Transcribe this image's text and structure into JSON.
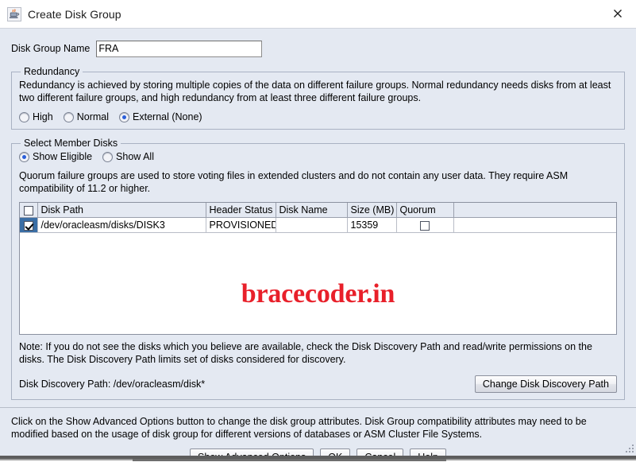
{
  "window": {
    "title": "Create Disk Group",
    "icon": "java-coffee-cup-icon",
    "close_label": "×"
  },
  "form": {
    "disk_group_name_label": "Disk Group Name",
    "disk_group_name_value": "FRA",
    "disk_group_name_placeholder": ""
  },
  "redundancy": {
    "legend": "Redundancy",
    "description": "Redundancy is achieved by storing multiple copies of the data on different failure groups. Normal redundancy needs disks from at least two different failure groups, and high redundancy from at least three different failure groups.",
    "options": [
      {
        "label": "High",
        "selected": false
      },
      {
        "label": "Normal",
        "selected": false
      },
      {
        "label": "External (None)",
        "selected": true
      }
    ]
  },
  "members": {
    "legend": "Select Member Disks",
    "filter_options": [
      {
        "label": "Show Eligible",
        "selected": true
      },
      {
        "label": "Show All",
        "selected": false
      }
    ],
    "quorum_note": "Quorum failure groups are used to store voting files in extended clusters and do not contain any user data. They require ASM compatibility of 11.2 or higher.",
    "table": {
      "columns": [
        "",
        "Disk Path",
        "Header Status",
        "Disk Name",
        "Size (MB)",
        "Quorum",
        ""
      ],
      "header_checkbox_checked": false,
      "rows": [
        {
          "selected": true,
          "disk_path": "/dev/oracleasm/disks/DISK3",
          "header_status": "PROVISIONED",
          "disk_name": "",
          "size_mb": "15359",
          "quorum_checked": false
        }
      ]
    },
    "watermark": "bracecoder.in",
    "note": "Note: If you do not see the disks which you believe are available, check the Disk Discovery Path and read/write permissions on the disks. The Disk Discovery Path limits set of disks considered for discovery.",
    "discovery_path_label": "Disk Discovery Path: /dev/oracleasm/disk*",
    "change_discovery_button": "Change Disk Discovery Path"
  },
  "footer": {
    "hint": "Click on the Show Advanced Options button to change the disk group attributes. Disk Group compatibility attributes may need to be modified based on the usage of disk group for different versions of databases or ASM Cluster File Systems.",
    "buttons": [
      {
        "label": "Show Advanced Options",
        "name": "show-advanced-options-button"
      },
      {
        "label": "OK",
        "name": "ok-button"
      },
      {
        "label": "Cancel",
        "name": "cancel-button"
      },
      {
        "label": "Help",
        "name": "help-button"
      }
    ]
  },
  "colors": {
    "dialog_bg": "#e4e9f2",
    "selection_blue": "#3a6ea5",
    "radio_accent": "#2b5fd9",
    "watermark_red": "#e8202a"
  }
}
